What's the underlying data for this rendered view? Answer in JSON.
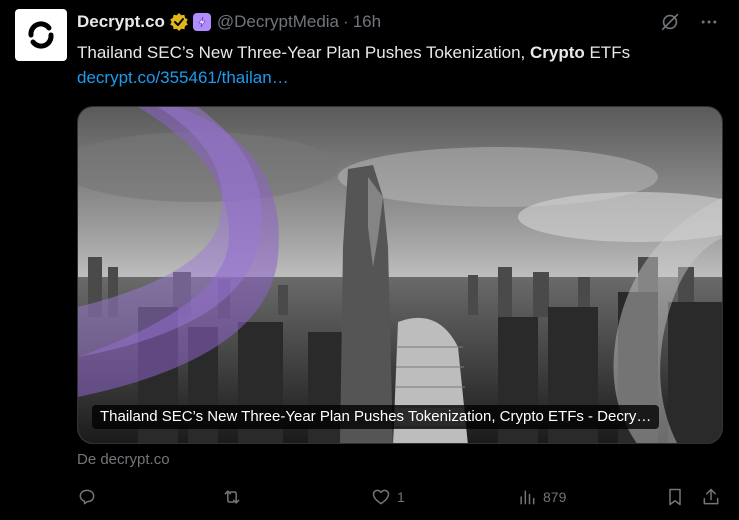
{
  "author": {
    "name": "Decrypt.co",
    "handle": "@DecryptMedia",
    "separator": "·",
    "time": "16h",
    "verified": "gold-verified-badge-icon",
    "affiliate": "purple-lightning-badge-icon"
  },
  "tweet": {
    "text_before": "Thailand SEC’s New Three-Year Plan Pushes Tokenization, ",
    "text_bold": "Crypto",
    "text_after": " ETFs",
    "link": "decrypt.co/355461/thailan…"
  },
  "card": {
    "caption": "Thailand SEC’s New Three-Year Plan Pushes Tokenization, Crypto ETFs - Decry…",
    "source": "De decrypt.co"
  },
  "actions": {
    "reply_count": "",
    "retweet_count": "",
    "like_count": "1",
    "views_count": "879"
  },
  "colors": {
    "background": "#000000",
    "text": "#e7e9ea",
    "muted": "#71767b",
    "link": "#1d9bf0",
    "accent_purple": "#8a63c7"
  }
}
